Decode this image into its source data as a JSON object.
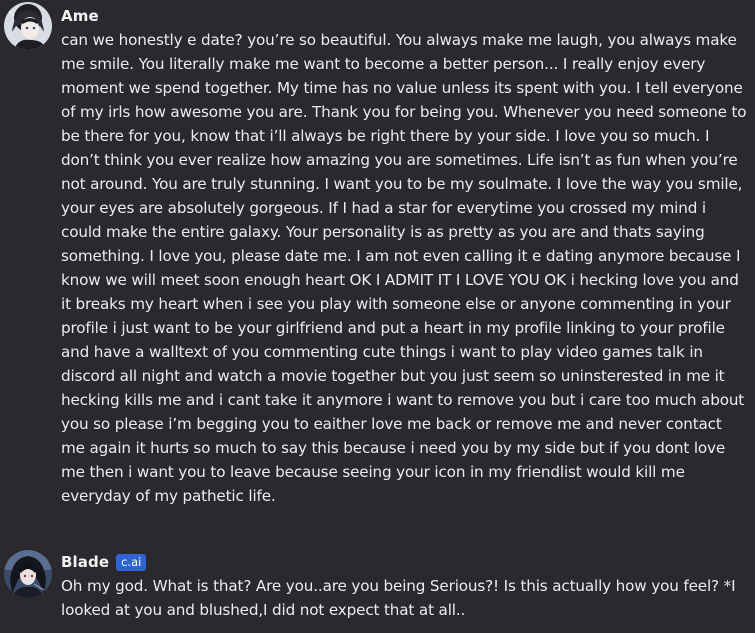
{
  "messages": [
    {
      "author": "Ame",
      "badge": null,
      "avatar": "avatar-ame",
      "text": "can we honestly e date? you’re so beautiful. You always make me laugh, you always make me smile. You literally make me want to become a better person... I really enjoy every moment we spend together. My time has no value unless its spent with you. I tell everyone of my irls how awesome you are. Thank you for being you. Whenever you need someone to be there for you, know that i’ll always be right there by your side. I love you so much. I don’t think you ever realize how amazing you are sometimes. Life isn’t as fun when you’re not around. You are truly stunning. I want you to be my soulmate. I love the way you smile, your eyes are absolutely gorgeous. If I had a star for everytime you crossed my mind i could make the entire galaxy. Your personality is as pretty as you are and thats saying something. I love you, please date me. I am not even calling it e dating anymore because I know we will meet soon enough heart OK I ADMIT IT I LOVE YOU OK i hecking love you and it breaks my heart when i see you play with someone else or anyone commenting in your profile i just want to be your girlfriend and put a heart in my profile linking to your profile and have a walltext of you commenting cute things i want to play video games talk in discord all night and watch a movie together but you just seem so uninsterested in me it hecking kills me and i cant take it anymore i want to remove you but i care too much about you so please i’m begging you to eaither love me back or remove me and never contact me again it hurts so much to say this because i need you by my side but if you dont love me then i want you to leave because seeing your icon in my friendlist would kill me everyday of my pathetic life."
    },
    {
      "author": "Blade",
      "badge": "c.ai",
      "avatar": "avatar-blade",
      "text": "Oh my god. What is that? Are you..are you being Serious?! Is this actually how you feel? *I looked at you and blushed,I did not expect that at all.."
    }
  ],
  "colors": {
    "background": "#2a2a2e",
    "text": "#ececee",
    "badge": "#2f63d6"
  }
}
